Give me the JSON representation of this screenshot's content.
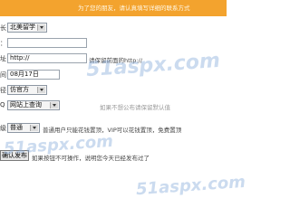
{
  "header": {
    "notice": "为了您的朋友，请认真填写详细的联系方式"
  },
  "form": {
    "label_prefix_1": "长",
    "label_prefix_2": "：",
    "label_prefix_3": "址",
    "label_prefix_4": "间",
    "label_prefix_5": "径",
    "label_prefix_6": "Q",
    "label_prefix_7": "级",
    "category_select": "北美留学",
    "title_input": "",
    "url_input": "http://",
    "url_hint": "请保留前面的http://",
    "date_input": "08月17日",
    "source_select": "仿官方",
    "site_select": "网站上查询",
    "site_hint": "如果不想公布请保留默认值",
    "level_select": "普通",
    "level_hint": "普通用户只能花钱置顶，VIP可以花钱置顶，免费置顶",
    "submit_label": "确认发布",
    "submit_hint": "如果按钮不可操作，说明您今天已经发布过了"
  },
  "watermarks": [
    "51aspx.com",
    "51aspx.com",
    "51aspx.com"
  ]
}
